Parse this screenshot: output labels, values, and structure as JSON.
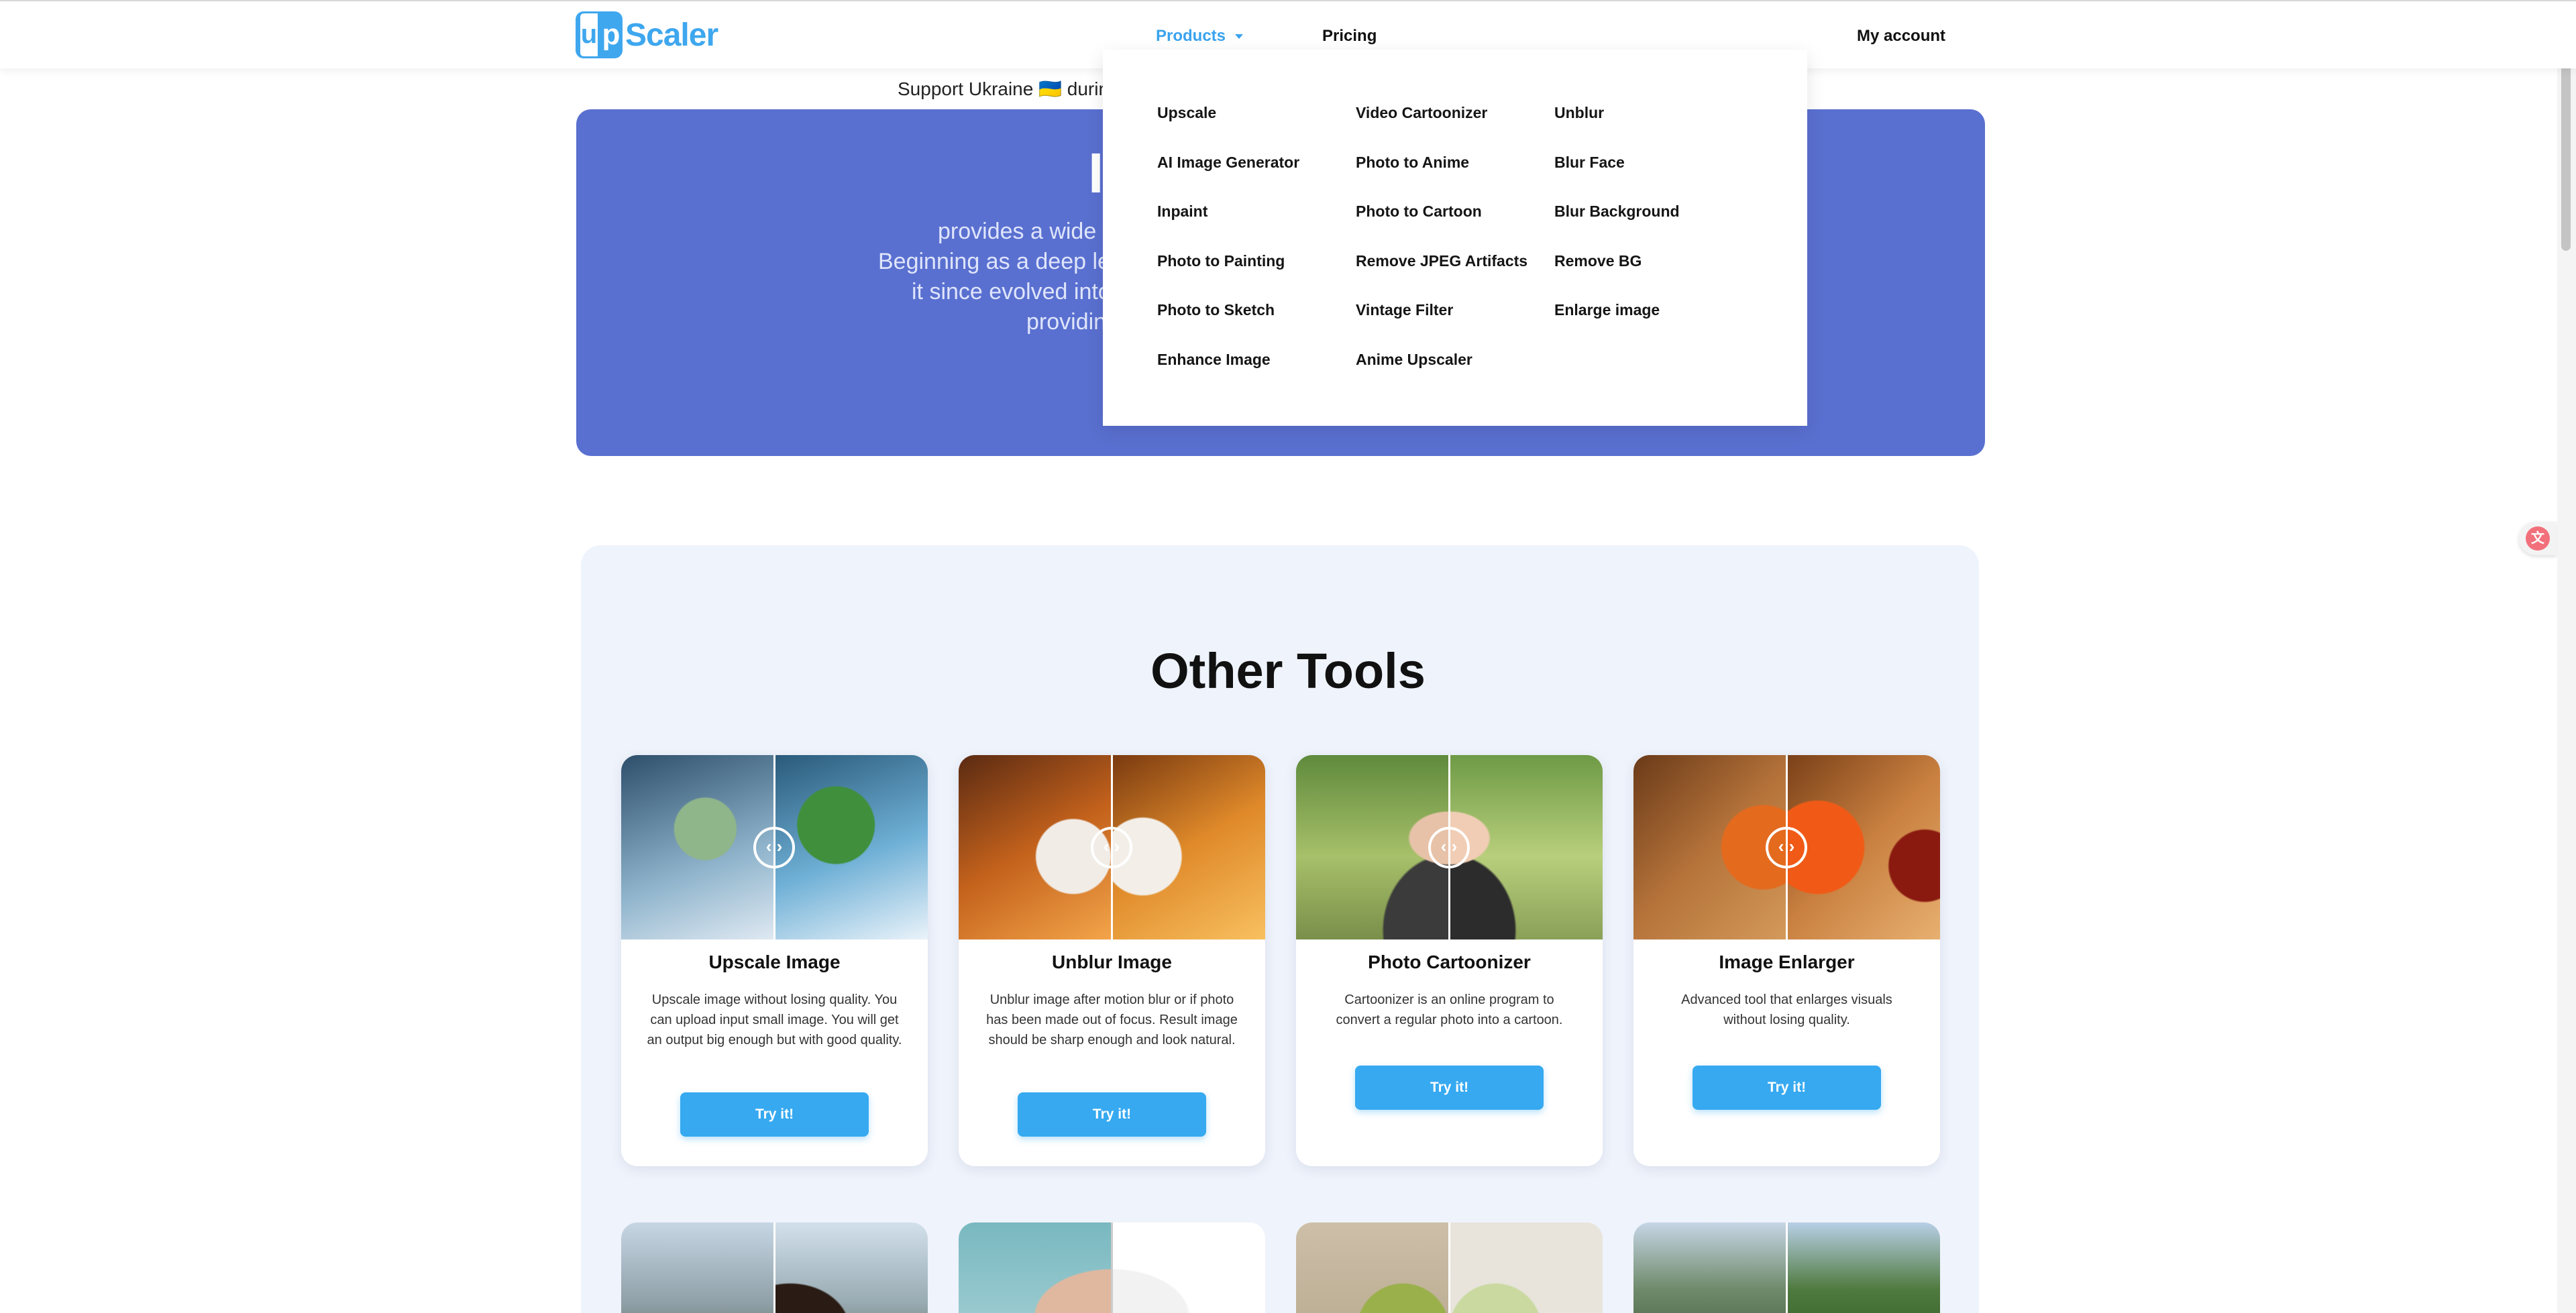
{
  "header": {
    "logo_text": "Scaler",
    "logo_mark": "Up",
    "nav": {
      "products": "Products",
      "pricing": "Pricing",
      "my_account": "My account"
    }
  },
  "support": {
    "text": "Support Ukraine 🇺🇦 during"
  },
  "hero": {
    "title": "I",
    "lines": [
      "provides a wide",
      "Beginning as a deep le",
      "it since evolved into",
      "providin"
    ]
  },
  "dropdown": {
    "columns": [
      [
        "Upscale",
        "AI Image Generator",
        "Inpaint",
        "Photo to Painting",
        "Photo to Sketch",
        "Enhance Image"
      ],
      [
        "Video Cartoonizer",
        "Photo to Anime",
        "Photo to Cartoon",
        "Remove JPEG Artifacts",
        "Vintage Filter",
        "Anime Upscaler"
      ],
      [
        "Unblur",
        "Blur Face",
        "Blur Background",
        "Remove BG",
        "Enlarge image"
      ]
    ]
  },
  "tools": {
    "title": "Other Tools",
    "cards": [
      {
        "title": "Upscale Image",
        "desc": "Upscale image without losing quality. You can upload input small image. You will get an output big enough but with good quality.",
        "button": "Try it!"
      },
      {
        "title": "Unblur Image",
        "desc": "Unblur image after motion blur or if photo has been made out of focus. Result image should be sharp enough and look natural.",
        "button": "Try it!"
      },
      {
        "title": "Photo Cartoonizer",
        "desc": "Cartoonizer is an online program to convert a regular photo into a cartoon.",
        "button": "Try it!"
      },
      {
        "title": "Image Enlarger",
        "desc": "Advanced tool that enlarges visuals without losing quality.",
        "button": "Try it!"
      }
    ]
  },
  "icons": {
    "caret": "chevron-down-icon",
    "slider_knob": "compare-slider-icon",
    "translate": "translate-icon"
  },
  "colors": {
    "brand": "#3ea7ee",
    "hero_bg": "#5a70d0",
    "button": "#36a9f0",
    "panel_bg": "#eff3fb"
  }
}
